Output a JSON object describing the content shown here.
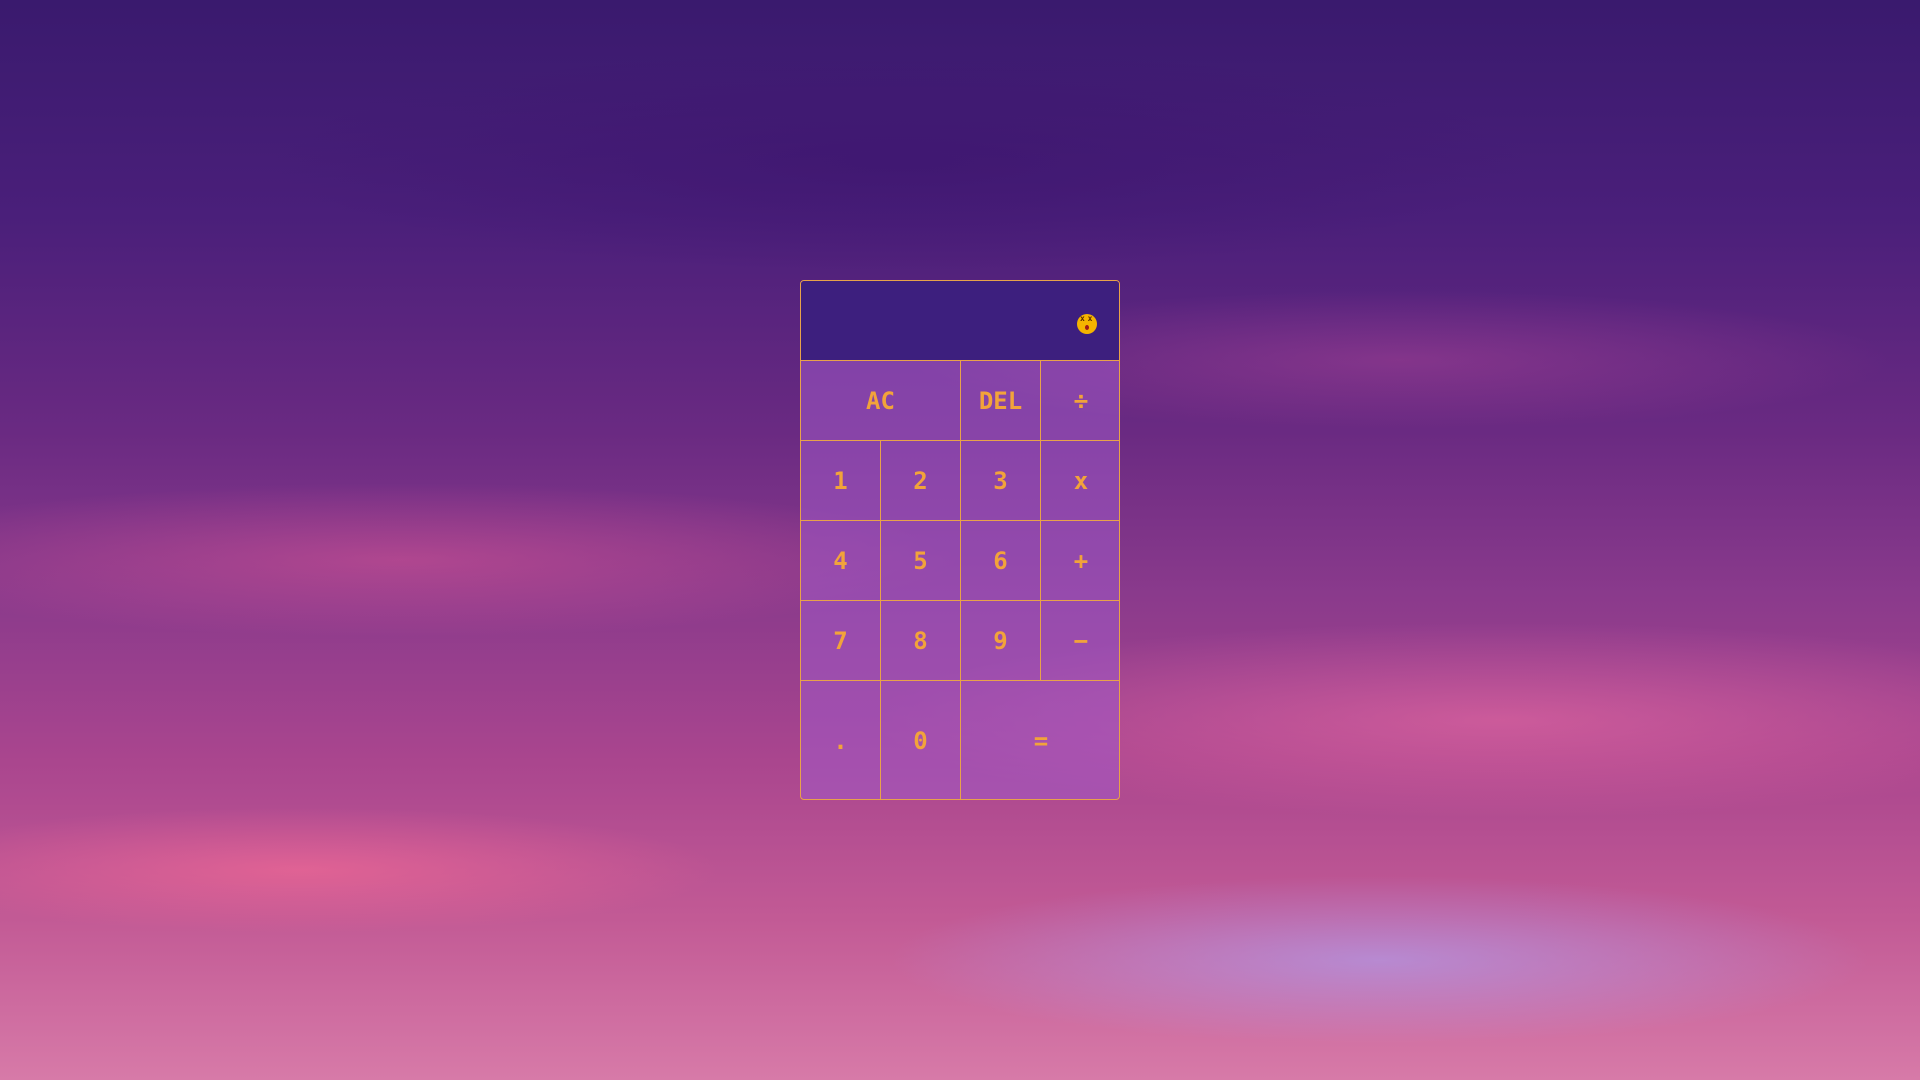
{
  "display": {
    "value": ""
  },
  "keys": {
    "ac": "AC",
    "del": "DEL",
    "divide": "÷",
    "one": "1",
    "two": "2",
    "three": "3",
    "multiply": "x",
    "four": "4",
    "five": "5",
    "six": "6",
    "add": "+",
    "seven": "7",
    "eight": "8",
    "nine": "9",
    "subtract": "−",
    "decimal": ".",
    "zero": "0",
    "equals": "="
  },
  "colors": {
    "accent": "#f2a33a",
    "display_bg": "#3d1f7e",
    "border": "#e8a24a"
  },
  "icons": {
    "status": "dizzy-face-icon"
  }
}
